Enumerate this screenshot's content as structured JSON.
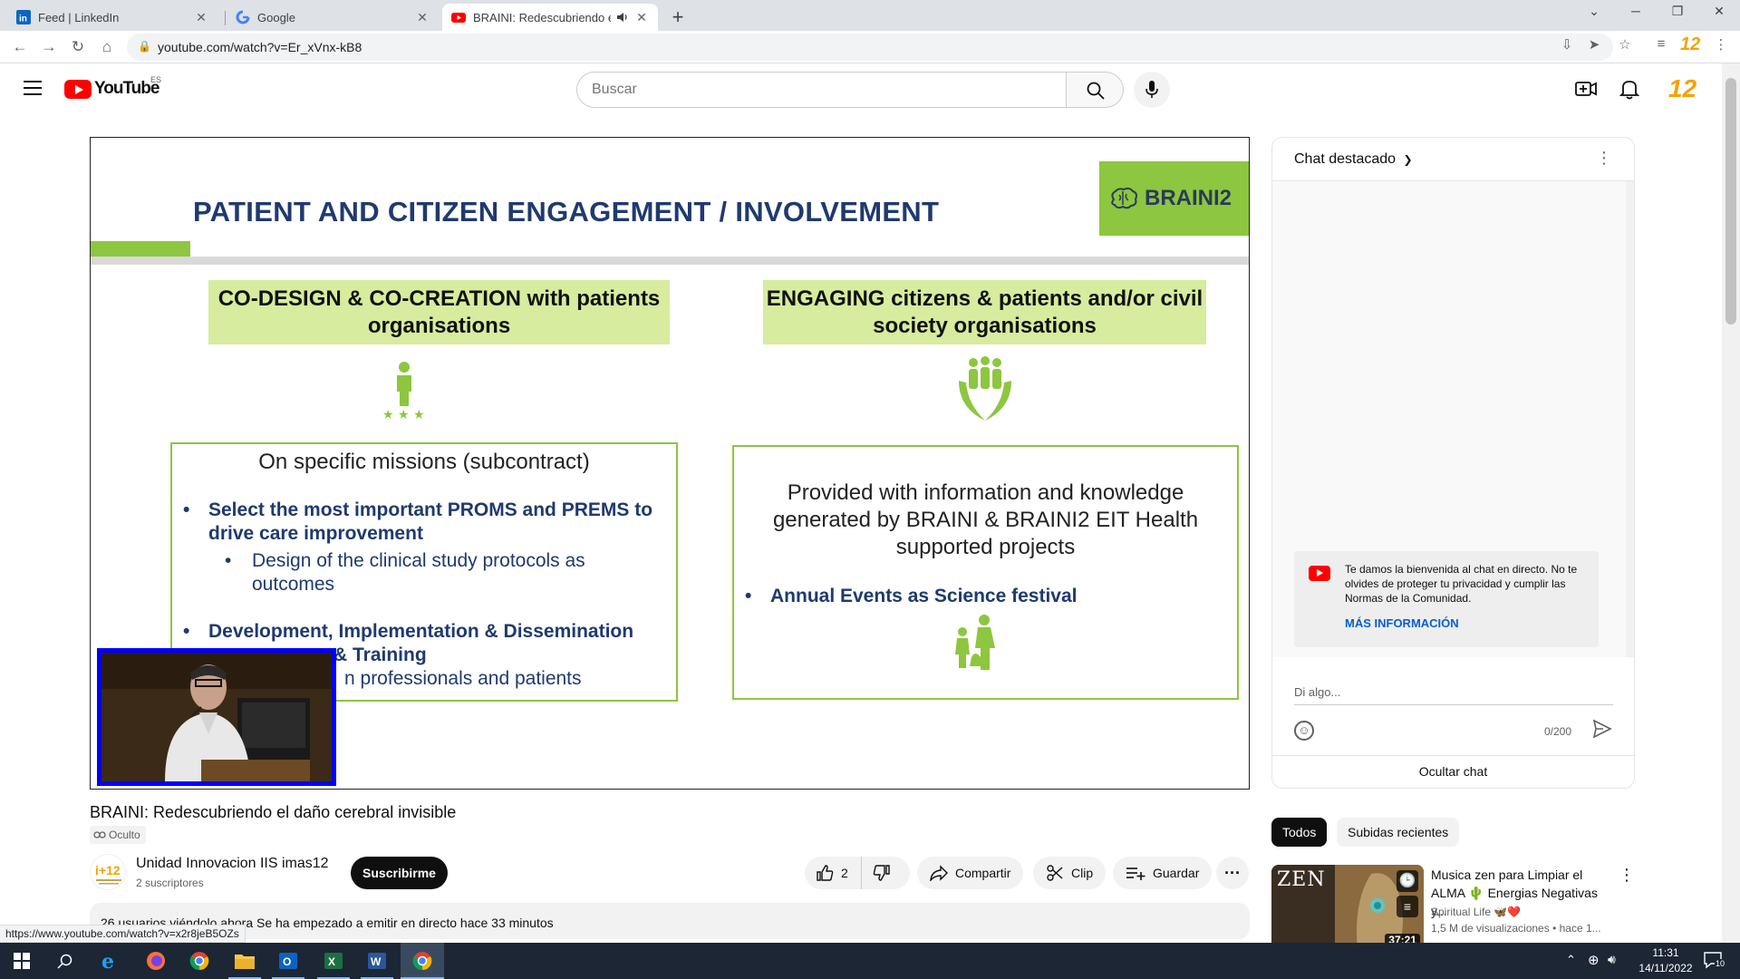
{
  "browser": {
    "tabs": [
      {
        "title": "Feed | LinkedIn"
      },
      {
        "title": "Google"
      },
      {
        "title": "BRAINI: Redescubriendo el daño cerebral invisible"
      }
    ],
    "url": "youtube.com/watch?v=Er_xVnx-kB8",
    "ext_label": "12"
  },
  "youtube": {
    "logo_text": "YouTube",
    "country_code": "ES",
    "search_placeholder": "Buscar",
    "brand_label": "12"
  },
  "slide": {
    "title": "PATIENT AND CITIZEN ENGAGEMENT / INVOLVEMENT",
    "logo": "BRAINI2",
    "left_header": "CO-DESIGN & CO-CREATION with patients organisations",
    "right_header": "ENGAGING citizens & patients and/or civil society organisations",
    "left_box": {
      "heading": "On specific missions (subcontract)",
      "bullet1": "Select the most important PROMS and PREMS to drive care improvement",
      "sub1": "Design of the clinical study protocols as outcomes",
      "bullet2a": "Development, Implementation & Dissemination",
      "bullet2b": "& Training",
      "bullet2c": "n professionals and patients"
    },
    "right_box": {
      "heading": "Provided with information and knowledge generated by BRAINI & BRAINI2 EIT Health supported projects",
      "bullet1": "Annual Events as Science festival"
    }
  },
  "video": {
    "title": "BRAINI: Redescubriendo el daño cerebral invisible",
    "visibility": "Oculto",
    "channel": "Unidad Innovacion IIS imas12",
    "subscribers": "2 suscriptores",
    "subscribe_label": "Suscribirme",
    "likes": "2",
    "share_label": "Compartir",
    "clip_label": "Clip",
    "save_label": "Guardar",
    "description": "26 usuarios viéndolo ahora  Se ha empezado a emitir en directo hace 33 minutos"
  },
  "chat": {
    "header": "Chat destacado",
    "welcome_text": "Te damos la bienvenida al chat en directo. No te olvides de proteger tu privacidad y cumplir las Normas de la Comunidad.",
    "more_info": "MÁS INFORMACIÓN",
    "input_placeholder": "Di algo...",
    "counter": "0/200",
    "hide_label": "Ocultar chat"
  },
  "recommendations": {
    "chips": [
      "Todos",
      "Subidas recientes"
    ],
    "items": [
      {
        "thumb_text": "ZEN",
        "duration": "37:21",
        "title": "Musica zen para Limpiar el ALMA 🌵 Energias Negativas y...",
        "channel": "Spiritual Life 🦋❤️",
        "meta": "1,5 M de visualizaciones  • hace 1..."
      }
    ]
  },
  "status_url": "https://www.youtube.com/watch?v=x2r8jeB5OZs",
  "taskbar": {
    "time": "11:31",
    "date": "14/11/2022",
    "notif_count": "10"
  },
  "colors": {
    "yt_red": "#ff0000",
    "slide_green": "#8dc63f",
    "slide_header_bg": "#d7ec9e",
    "slide_navy": "#1f3a6e",
    "link_blue": "#065fd4",
    "taskbar": "#1c2635"
  }
}
